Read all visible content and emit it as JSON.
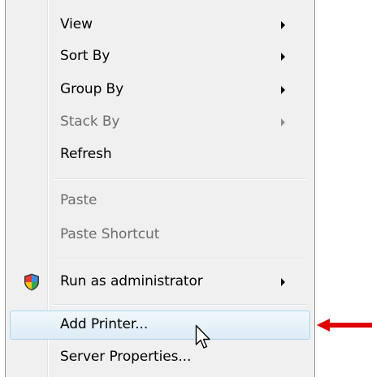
{
  "menu": {
    "items": [
      {
        "label": "View",
        "has_submenu": true,
        "disabled": false
      },
      {
        "label": "Sort By",
        "has_submenu": true,
        "disabled": false
      },
      {
        "label": "Group By",
        "has_submenu": true,
        "disabled": false
      },
      {
        "label": "Stack By",
        "has_submenu": true,
        "disabled": true
      },
      {
        "label": "Refresh",
        "has_submenu": false,
        "disabled": false
      },
      {
        "label": "Paste",
        "has_submenu": false,
        "disabled": true
      },
      {
        "label": "Paste Shortcut",
        "has_submenu": false,
        "disabled": true
      },
      {
        "label": "Run as administrator",
        "has_submenu": true,
        "disabled": false,
        "icon": "uac-shield-icon"
      },
      {
        "label": "Add Printer...",
        "has_submenu": false,
        "disabled": false,
        "highlighted": true
      },
      {
        "label": "Server Properties...",
        "has_submenu": false,
        "disabled": false
      }
    ]
  },
  "annotation": {
    "arrow_color": "#e00000",
    "points_to": "Add Printer..."
  },
  "colors": {
    "menu_background": "#f0f0f0",
    "hover_border": "#a8d8eb",
    "disabled_text": "#6d6d6d"
  }
}
